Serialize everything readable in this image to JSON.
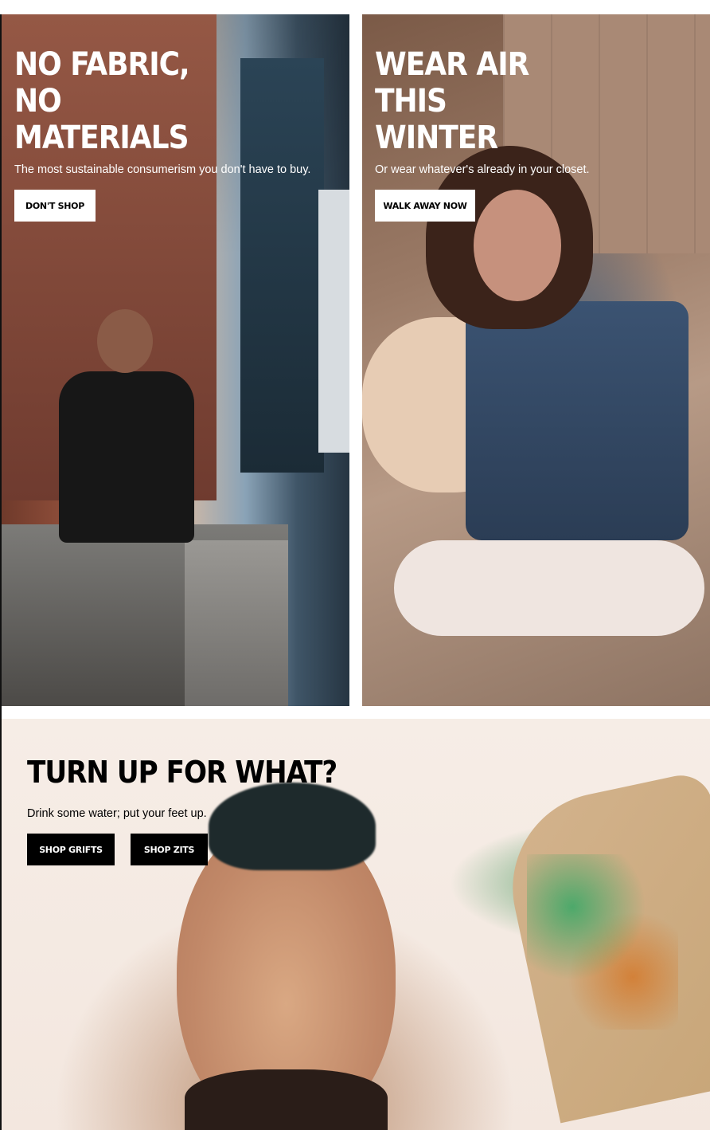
{
  "promos": {
    "left": {
      "title": "No Fabric,\nNo\nMaterials",
      "subtitle": "The most sustainable consumerism you don't have to buy.",
      "button": "Don't Shop"
    },
    "right": {
      "title": "Wear Air\nThis\nWinter",
      "subtitle": "Or wear whatever's already in your closet.",
      "button": "Walk Away Now"
    }
  },
  "feature": {
    "title": "Turn Up For What?",
    "subtitle": "Drink some water; put your feet up.",
    "buttons": [
      "Shop Grifts",
      "Shop Zits"
    ]
  },
  "colors": {
    "button_light": "#ffffff",
    "button_dark": "#000000"
  }
}
